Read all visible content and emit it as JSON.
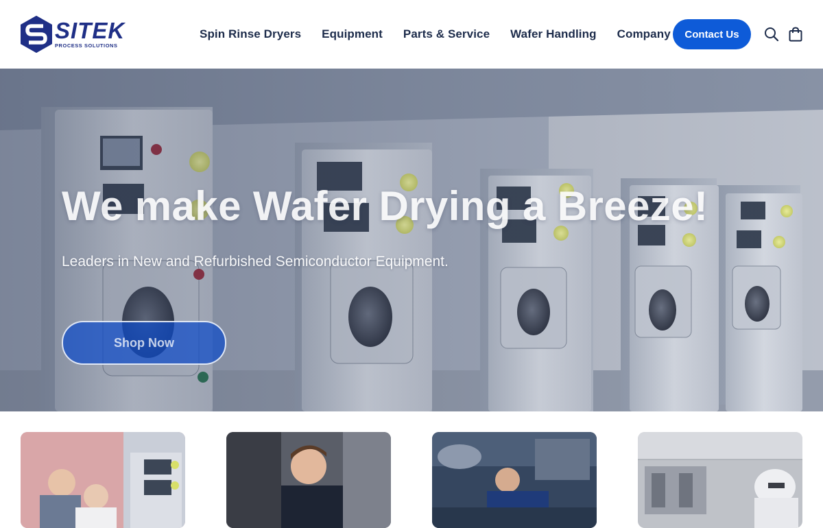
{
  "brand": {
    "name": "SITEK",
    "tagline": "PROCESS SOLUTIONS",
    "color": "#1f2f86"
  },
  "nav": {
    "items": [
      {
        "label": "Spin Rinse Dryers"
      },
      {
        "label": "Equipment"
      },
      {
        "label": "Parts & Service"
      },
      {
        "label": "Wafer Handling"
      },
      {
        "label": "Company"
      }
    ],
    "contact_label": "Contact Us",
    "search_icon": "search-icon",
    "cart_icon": "shopping-bag-icon"
  },
  "hero": {
    "title": "We make Wafer Drying a Breeze!",
    "subtitle": "Leaders in New and Refurbished Semiconductor Equipment.",
    "cta_label": "Shop Now",
    "image": "row of spin rinse dryer machines"
  },
  "cards": [
    {
      "image": "engineers inspecting spin rinse dryers"
    },
    {
      "image": "technician working on equipment"
    },
    {
      "image": "technician repairing parts"
    },
    {
      "image": "cleanroom worker in bunny suit"
    }
  ],
  "colors": {
    "accent": "#0e5bd8",
    "nav_text": "#1c2b4a"
  }
}
